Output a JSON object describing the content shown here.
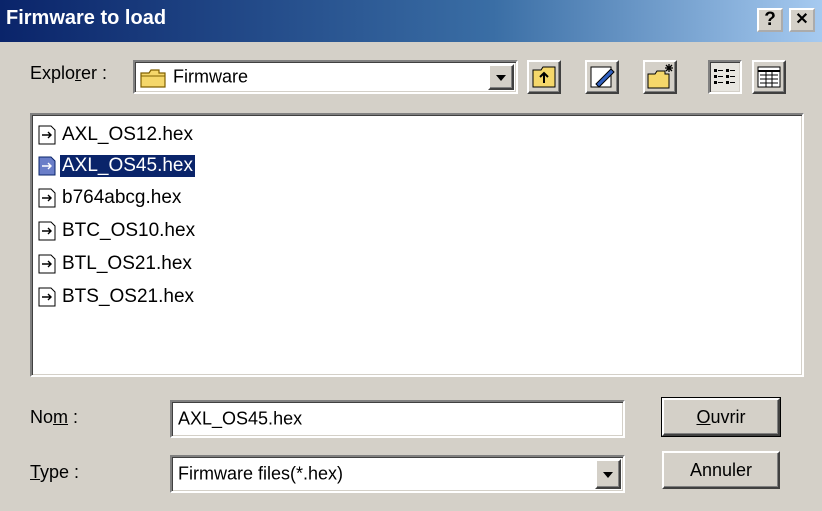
{
  "window": {
    "title": "Firmware to load",
    "help_label": "?",
    "close_label": "✕"
  },
  "lookin": {
    "label_pre": "Explo",
    "label_key": "r",
    "label_post": "er :",
    "value": "Firmware"
  },
  "toolbar": {
    "buttons": [
      {
        "icon": "up-folder-icon"
      },
      {
        "icon": "edit-icon"
      },
      {
        "icon": "new-folder-icon"
      },
      {
        "icon": "list-view-icon"
      },
      {
        "icon": "details-view-icon"
      }
    ]
  },
  "files": [
    {
      "name": "AXL_OS12.hex",
      "selected": false
    },
    {
      "name": "AXL_OS45.hex",
      "selected": true
    },
    {
      "name": "b764abcg.hex",
      "selected": false
    },
    {
      "name": "BTC_OS10.hex",
      "selected": false
    },
    {
      "name": "BTL_OS21.hex",
      "selected": false
    },
    {
      "name": "BTS_OS21.hex",
      "selected": false
    }
  ],
  "filename": {
    "label_pre": "No",
    "label_key": "m",
    "label_post": " :",
    "value": "AXL_OS45.hex"
  },
  "filetype": {
    "label_key": "T",
    "label_post": "ype :",
    "value": "Firmware files(*.hex)"
  },
  "buttons": {
    "open_key": "O",
    "open_rest": "uvrir",
    "cancel": "Annuler"
  },
  "colors": {
    "title_start": "#0a246a",
    "title_end": "#a6caf0",
    "face": "#d4d0c8",
    "selection": "#0a246a"
  }
}
